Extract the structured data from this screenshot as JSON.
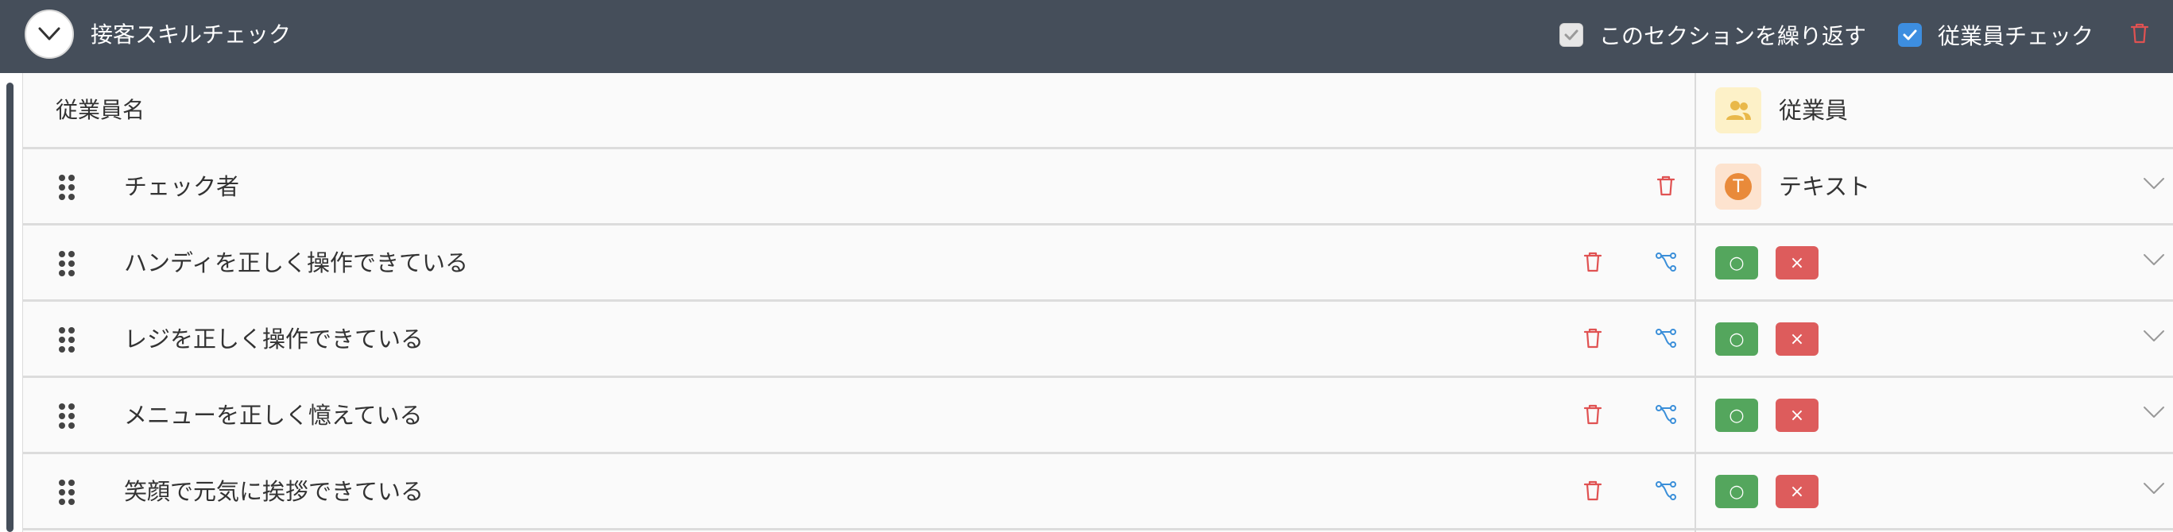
{
  "section": {
    "title": "接客スキルチェック",
    "repeat_label": "このセクションを繰り返す",
    "repeat_checked": false,
    "employee_check_label": "従業員チェック",
    "employee_check_checked": true
  },
  "header": {
    "left_label": "従業員名",
    "right_label": "従業員",
    "right_icon": "people-icon",
    "right_icon_color": "#e9b84a"
  },
  "rows": [
    {
      "label": "チェック者",
      "type": "text",
      "type_label": "テキスト",
      "type_icon": "T",
      "type_color": "#e98a3a"
    },
    {
      "label": "ハンディを正しく操作できている",
      "type": "choice",
      "ok_label": "○",
      "ng_label": "×"
    },
    {
      "label": "レジを正しく操作できている",
      "type": "choice",
      "ok_label": "○",
      "ng_label": "×"
    },
    {
      "label": "メニューを正しく憶えている",
      "type": "choice",
      "ok_label": "○",
      "ng_label": "×"
    },
    {
      "label": "笑顔で元気に挨拶できている",
      "type": "choice",
      "ok_label": "○",
      "ng_label": "×"
    }
  ],
  "colors": {
    "topbar": "#454e5a",
    "trash": "#e05252",
    "branch": "#3b8fd9",
    "ok": "#54a65d",
    "ng": "#dd5c5c"
  }
}
